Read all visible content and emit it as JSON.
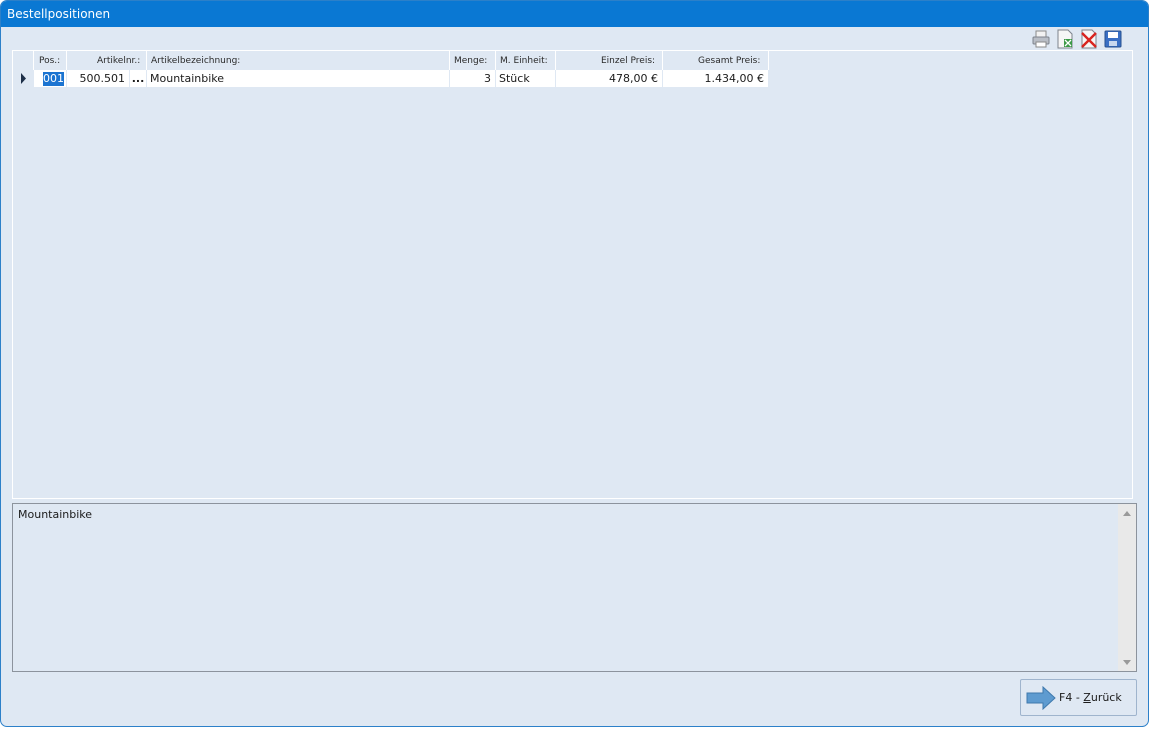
{
  "window": {
    "title": "Bestellpositionen"
  },
  "toolbar": {
    "buttons": [
      {
        "icon": "printer-icon"
      },
      {
        "icon": "export-excel-icon"
      },
      {
        "icon": "delete-icon"
      },
      {
        "icon": "save-icon"
      }
    ]
  },
  "grid": {
    "columns": [
      "Pos.:",
      "Artikelnr.:",
      "Artikelbezeichnung:",
      "Menge:",
      "M. Einheit:",
      "Einzel Preis:",
      "Gesamt Preis:"
    ],
    "rows": [
      {
        "pos": "001",
        "artikelnr": "500.501",
        "browse": "...",
        "bezeichnung": "Mountainbike",
        "menge": "3",
        "einheit": "Stück",
        "einzelpreis": "478,00 €",
        "gesamtpreis": "1.434,00 €"
      }
    ]
  },
  "memo": {
    "text": "Mountainbike"
  },
  "footer": {
    "back_prefix": "F4 - ",
    "back_hotkey": "Z",
    "back_rest": "urück"
  },
  "colors": {
    "title_bar": "#0a78d3",
    "window_bg": "#dfe8f3",
    "selection": "#1c74d1"
  }
}
